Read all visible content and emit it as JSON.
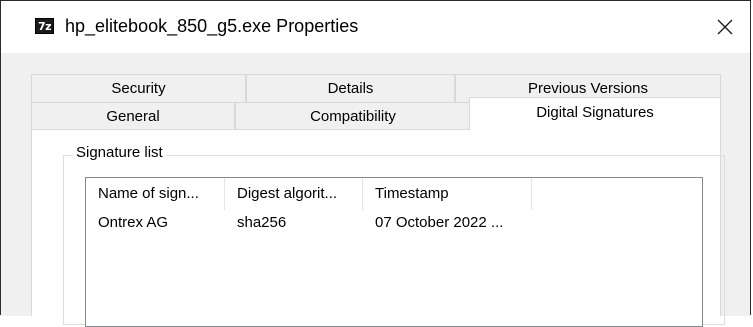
{
  "window": {
    "app_icon_text": "7z",
    "title": "hp_elitebook_850_g5.exe Properties"
  },
  "tabs": {
    "row1": [
      "Security",
      "Details",
      "Previous Versions"
    ],
    "row2": [
      "General",
      "Compatibility",
      "Digital Signatures"
    ],
    "active": "Digital Signatures"
  },
  "signatures": {
    "group_label": "Signature list",
    "columns": [
      "Name of sign...",
      "Digest algorit...",
      "Timestamp"
    ],
    "rows": [
      [
        "Ontrex AG",
        "sha256",
        "07 October 2022 ..."
      ]
    ]
  },
  "colors": {
    "window_bg": "#ffffff",
    "client_bg": "#f0f0f0",
    "list_border": "#828790"
  }
}
